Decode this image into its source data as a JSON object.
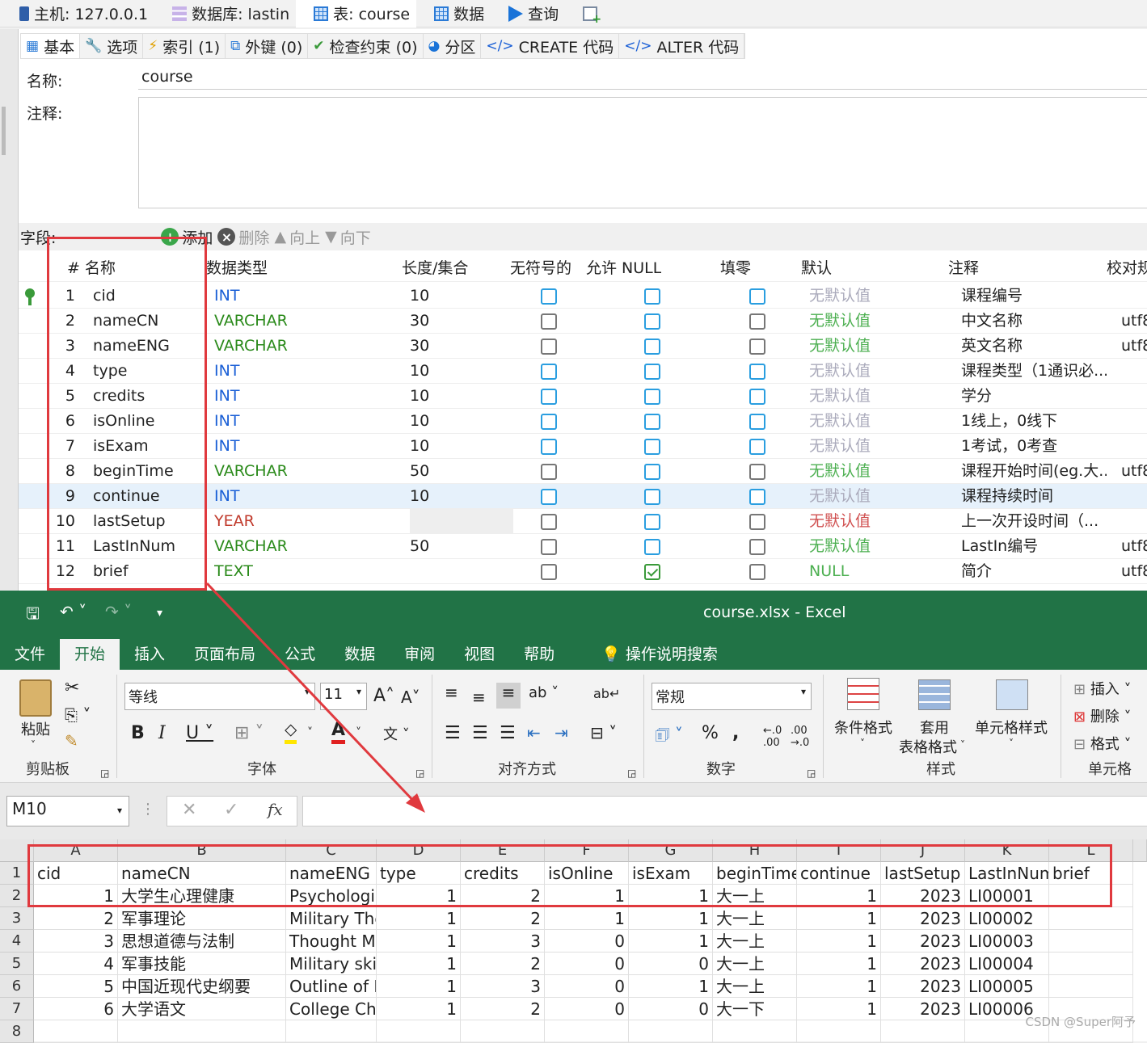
{
  "topbar": {
    "tabs": [
      {
        "icon": "host-icon",
        "label": "主机: 127.0.0.1"
      },
      {
        "icon": "database-icon",
        "label": "数据库: lastin"
      },
      {
        "icon": "table-icon",
        "label": "表: course"
      },
      {
        "icon": "data-grid-icon",
        "label": "数据"
      },
      {
        "icon": "query-play-icon",
        "label": "查询"
      },
      {
        "icon": "new-query-icon",
        "label": ""
      }
    ]
  },
  "subtabs": [
    {
      "icon": "table-icon",
      "label": "基本"
    },
    {
      "icon": "wrench-icon",
      "label": "选项"
    },
    {
      "icon": "lightning-icon",
      "label": "索引 (1)"
    },
    {
      "icon": "foreign-key-icon",
      "label": "外键 (0)"
    },
    {
      "icon": "check-icon",
      "label": "检查约束 (0)"
    },
    {
      "icon": "partition-icon",
      "label": "分区"
    },
    {
      "icon": "code-icon",
      "label": "CREATE 代码"
    },
    {
      "icon": "code-icon",
      "label": "ALTER 代码"
    }
  ],
  "form": {
    "name_label": "名称:",
    "name_value": "course",
    "comment_label": "注释:"
  },
  "fields": {
    "label": "字段:",
    "add": "添加",
    "delete": "删除",
    "up": "向上",
    "down": "向下"
  },
  "columns_header": [
    "#",
    "名称",
    "数据类型",
    "长度/集合",
    "无符号的",
    "允许 NULL",
    "填零",
    "默认",
    "注释",
    "校对规"
  ],
  "columns": [
    {
      "n": "1",
      "name": "cid",
      "type": "INT",
      "tc": "t-int",
      "len": "10",
      "uns": "b",
      "nul": "b",
      "zf": "b",
      "def": "无默认值",
      "dc": "d-g",
      "cmt": "课程编号",
      "col": "",
      "key": true
    },
    {
      "n": "2",
      "name": "nameCN",
      "type": "VARCHAR",
      "tc": "t-vc",
      "len": "30",
      "uns": "",
      "nul": "b",
      "zf": "",
      "def": "无默认值",
      "dc": "d-gr",
      "cmt": "中文名称",
      "col": "utf8"
    },
    {
      "n": "3",
      "name": "nameENG",
      "type": "VARCHAR",
      "tc": "t-vc",
      "len": "30",
      "uns": "",
      "nul": "b",
      "zf": "",
      "def": "无默认值",
      "dc": "d-gr",
      "cmt": "英文名称",
      "col": "utf8"
    },
    {
      "n": "4",
      "name": "type",
      "type": "INT",
      "tc": "t-int",
      "len": "10",
      "uns": "b",
      "nul": "b",
      "zf": "b",
      "def": "无默认值",
      "dc": "d-g",
      "cmt": "课程类型（1通识必...",
      "col": ""
    },
    {
      "n": "5",
      "name": "credits",
      "type": "INT",
      "tc": "t-int",
      "len": "10",
      "uns": "b",
      "nul": "b",
      "zf": "b",
      "def": "无默认值",
      "dc": "d-g",
      "cmt": "学分",
      "col": ""
    },
    {
      "n": "6",
      "name": "isOnline",
      "type": "INT",
      "tc": "t-int",
      "len": "10",
      "uns": "b",
      "nul": "b",
      "zf": "b",
      "def": "无默认值",
      "dc": "d-g",
      "cmt": "1线上，0线下",
      "col": ""
    },
    {
      "n": "7",
      "name": "isExam",
      "type": "INT",
      "tc": "t-int",
      "len": "10",
      "uns": "b",
      "nul": "b",
      "zf": "b",
      "def": "无默认值",
      "dc": "d-g",
      "cmt": "1考试，0考查",
      "col": ""
    },
    {
      "n": "8",
      "name": "beginTime",
      "type": "VARCHAR",
      "tc": "t-vc",
      "len": "50",
      "uns": "",
      "nul": "b",
      "zf": "",
      "def": "无默认值",
      "dc": "d-gr",
      "cmt": "课程开始时间(eg.大...",
      "col": "utf8"
    },
    {
      "n": "9",
      "name": "continue",
      "type": "INT",
      "tc": "t-int",
      "len": "10",
      "uns": "b",
      "nul": "b",
      "zf": "b",
      "def": "无默认值",
      "dc": "d-g",
      "cmt": "课程持续时间",
      "col": "",
      "sel": true
    },
    {
      "n": "10",
      "name": "lastSetup",
      "type": "YEAR",
      "tc": "t-yr",
      "len": "",
      "uns": "",
      "nul": "b",
      "zf": "",
      "def": "无默认值",
      "dc": "d-r",
      "cmt": "上一次开设时间（...",
      "col": ""
    },
    {
      "n": "11",
      "name": "LastInNum",
      "type": "VARCHAR",
      "tc": "t-vc",
      "len": "50",
      "uns": "",
      "nul": "b",
      "zf": "",
      "def": "无默认值",
      "dc": "d-gr",
      "cmt": "LastIn编号",
      "col": "utf8"
    },
    {
      "n": "12",
      "name": "brief",
      "type": "TEXT",
      "tc": "t-tx",
      "len": "",
      "uns": "",
      "nul": "g",
      "zf": "",
      "def": "NULL",
      "dc": "d-gr",
      "cmt": "简介",
      "col": "utf8"
    }
  ],
  "excel": {
    "title": "course.xlsx  -  Excel",
    "menu": [
      "文件",
      "开始",
      "插入",
      "页面布局",
      "公式",
      "数据",
      "审阅",
      "视图",
      "帮助",
      "操作说明搜索"
    ],
    "clipboard": {
      "paste": "粘贴",
      "group": "剪贴板"
    },
    "font": {
      "name": "等线",
      "size": "11",
      "group": "字体"
    },
    "align": {
      "group": "对齐方式"
    },
    "number": {
      "format": "常规",
      "group": "数字"
    },
    "styles": {
      "cond": "条件格式",
      "table1": "套用",
      "table2": "表格格式",
      "cell": "单元格样式",
      "group": "样式"
    },
    "cells": {
      "insert": "插入",
      "delete": "删除",
      "format": "格式",
      "group": "单元格"
    },
    "namebox": "M10",
    "fx": "fx",
    "col_letters": [
      "A",
      "B",
      "C",
      "D",
      "E",
      "F",
      "G",
      "H",
      "I",
      "J",
      "K",
      "L"
    ],
    "row_numbers": [
      "1",
      "2",
      "3",
      "4",
      "5",
      "6",
      "7",
      "8"
    ],
    "rows": [
      [
        "cid",
        "nameCN",
        "nameENG",
        "type",
        "credits",
        "isOnline",
        "isExam",
        "beginTime",
        "continue",
        "lastSetup",
        "LastInNum",
        "brief"
      ],
      [
        "1",
        "大学生心理健康",
        "Psychologic",
        "1",
        "2",
        "1",
        "1",
        "大一上",
        "1",
        "2023",
        "LI00001",
        ""
      ],
      [
        "2",
        "军事理论",
        "Military The",
        "1",
        "2",
        "1",
        "1",
        "大一上",
        "1",
        "2023",
        "LI00002",
        ""
      ],
      [
        "3",
        "思想道德与法制",
        "Thought M",
        "1",
        "3",
        "0",
        "1",
        "大一上",
        "1",
        "2023",
        "LI00003",
        ""
      ],
      [
        "4",
        "军事技能",
        "Military skill",
        "1",
        "2",
        "0",
        "0",
        "大一上",
        "1",
        "2023",
        "LI00004",
        ""
      ],
      [
        "5",
        "中国近现代史纲要",
        "Outline of M",
        "1",
        "3",
        "0",
        "1",
        "大一上",
        "1",
        "2023",
        "LI00005",
        ""
      ],
      [
        "6",
        "大学语文",
        "College Chi",
        "1",
        "2",
        "0",
        "0",
        "大一下",
        "1",
        "2023",
        "LI00006",
        ""
      ]
    ]
  },
  "watermark": "CSDN @Super阿予"
}
